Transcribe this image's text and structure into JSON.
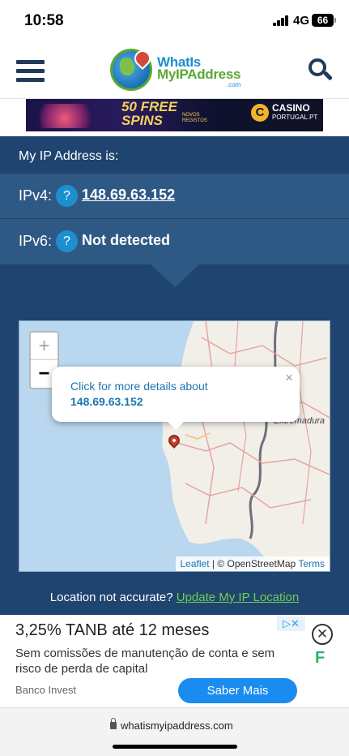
{
  "status_bar": {
    "time": "10:58",
    "network": "4G",
    "battery": "66"
  },
  "header": {
    "logo_line1": "WhatIs",
    "logo_line2": "MyIPAddress",
    "logo_line3": ".com",
    "menu_icon": "hamburger-menu-icon",
    "search_icon": "search-icon"
  },
  "top_ad": {
    "headline_top": "50 FREE",
    "headline_bottom": "SPINS",
    "small_text": "NOVOS REGISTOS",
    "brand_mark": "C",
    "brand": "CASINO",
    "brand_sub": "PORTUGAL.PT"
  },
  "ip_info": {
    "title": "My IP Address is:",
    "ipv4_label": "IPv4:",
    "ipv4_value": "148.69.63.152",
    "ipv6_label": "IPv6:",
    "ipv6_value": "Not detected",
    "help_glyph": "?"
  },
  "map": {
    "zoom_in": "+",
    "zoom_out": "−",
    "popup_text": "Click for more details about",
    "popup_ip": "148.69.63.152",
    "popup_close": "×",
    "region_label": "Extremadura",
    "attribution_leaflet": "Leaflet",
    "attribution_sep": " | © OpenStreetMap ",
    "attribution_terms": "Terms"
  },
  "location_note": {
    "text": "Location not accurate? ",
    "link": "Update My IP Location"
  },
  "bottom_ad": {
    "title": "3,25% TANB até 12 meses",
    "description": "Sem comissões de manutenção de conta e sem risco de perda de capital",
    "advertiser": "Banco Invest",
    "cta": "Saber Mais",
    "adchoices": "▷✕",
    "close": "✕",
    "brand_icon": "F"
  },
  "browser": {
    "url": "whatismyipaddress.com"
  }
}
